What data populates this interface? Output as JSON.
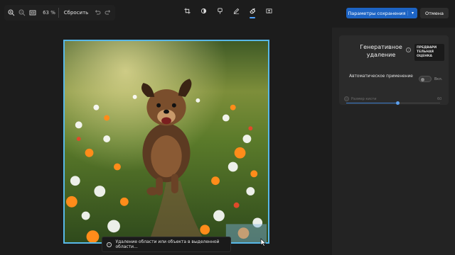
{
  "toolbar": {
    "zoom_value": "63 %",
    "reset_label": "Сбросить"
  },
  "tools": [
    {
      "name": "crop-icon"
    },
    {
      "name": "adjust-icon"
    },
    {
      "name": "filter-icon"
    },
    {
      "name": "markup-icon"
    },
    {
      "name": "erase-icon",
      "active": true
    },
    {
      "name": "background-icon"
    }
  ],
  "actions": {
    "save_label": "Параметры сохранения",
    "cancel_label": "Отмена"
  },
  "panel": {
    "title": "Генеративное удаление",
    "preview_badge": "ПРЕДВАРИ ТЕЛЬНАЯ ОЦЕНКА",
    "auto_apply_label": "Автоматическое применение",
    "toggle_label": "Вкл.",
    "brush_label": "Размер кисти",
    "brush_value": "60",
    "brush_level": 0.55
  },
  "tooltip": {
    "text": "Удаление области или объекта в выделенной области..."
  },
  "colors": {
    "accent": "#1d64c4",
    "selection": "#58b8e8",
    "panel_bg": "#232323",
    "app_bg": "#1c1c1c"
  }
}
